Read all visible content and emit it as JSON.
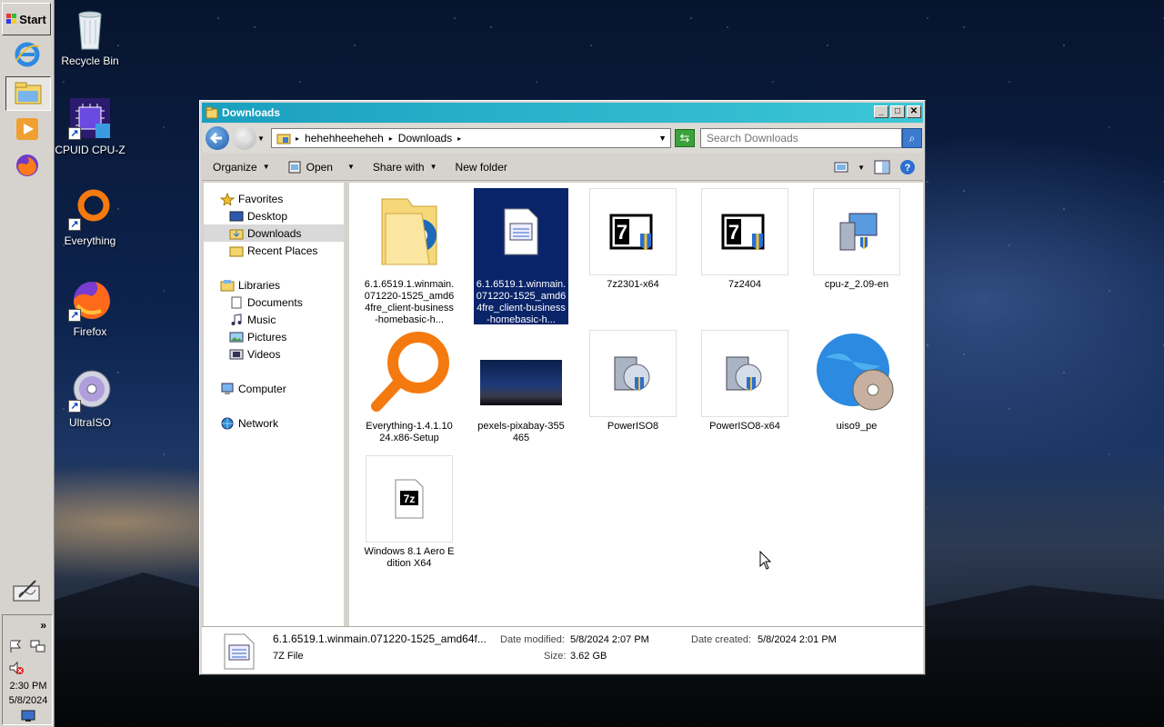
{
  "taskbar": {
    "start_label": "Start",
    "clock_time": "2:30 PM",
    "clock_date": "5/8/2024",
    "expand_label": "»"
  },
  "desktop": {
    "icons": [
      {
        "label": "Recycle Bin",
        "icon": "recycle-bin-icon"
      },
      {
        "label": "CPUID CPU-Z",
        "icon": "cpuz-icon"
      },
      {
        "label": "Everything",
        "icon": "everything-icon"
      },
      {
        "label": "Firefox",
        "icon": "firefox-icon"
      },
      {
        "label": "UltraISO",
        "icon": "ultraiso-icon"
      }
    ]
  },
  "window": {
    "title": "Downloads",
    "address": {
      "segments": [
        "hehehheeheheh",
        "Downloads"
      ]
    },
    "search_placeholder": "Search Downloads",
    "toolbar": {
      "organize": "Organize",
      "open": "Open",
      "share_with": "Share with",
      "new_folder": "New folder"
    },
    "nav": {
      "favorites": "Favorites",
      "desktop": "Desktop",
      "downloads": "Downloads",
      "recent_places": "Recent Places",
      "libraries": "Libraries",
      "documents": "Documents",
      "music": "Music",
      "pictures": "Pictures",
      "videos": "Videos",
      "computer": "Computer",
      "network": "Network"
    },
    "files": [
      {
        "name": "6.1.6519.1.winmain.071220-1525_amd64fre_client-business-homebasic-h...",
        "icon": "folder-icon"
      },
      {
        "name": "6.1.6519.1.winmain.071220-1525_amd64fre_client-business-homebasic-h...",
        "icon": "archive-file-icon",
        "selected": true
      },
      {
        "name": "7z2301-x64",
        "icon": "7zip-icon"
      },
      {
        "name": "7z2404",
        "icon": "7zip-icon"
      },
      {
        "name": "cpu-z_2.09-en",
        "icon": "installer-icon"
      },
      {
        "name": "Everything-1.4.1.1024.x86-Setup",
        "icon": "everything-icon"
      },
      {
        "name": "pexels-pixabay-355465",
        "icon": "image-thumbnail-icon"
      },
      {
        "name": "PowerISO8",
        "icon": "installer-icon"
      },
      {
        "name": "PowerISO8-x64",
        "icon": "installer-icon"
      },
      {
        "name": "uiso9_pe",
        "icon": "globe-disc-icon"
      },
      {
        "name": "Windows 8.1 Aero Edition X64",
        "icon": "7z-file-icon"
      }
    ],
    "details": {
      "filename": "6.1.6519.1.winmain.071220-1525_amd64f...",
      "type": "7Z File",
      "modified_label": "Date modified:",
      "modified_value": "5/8/2024 2:07 PM",
      "size_label": "Size:",
      "size_value": "3.62 GB",
      "created_label": "Date created:",
      "created_value": "5/8/2024 2:01 PM"
    }
  }
}
